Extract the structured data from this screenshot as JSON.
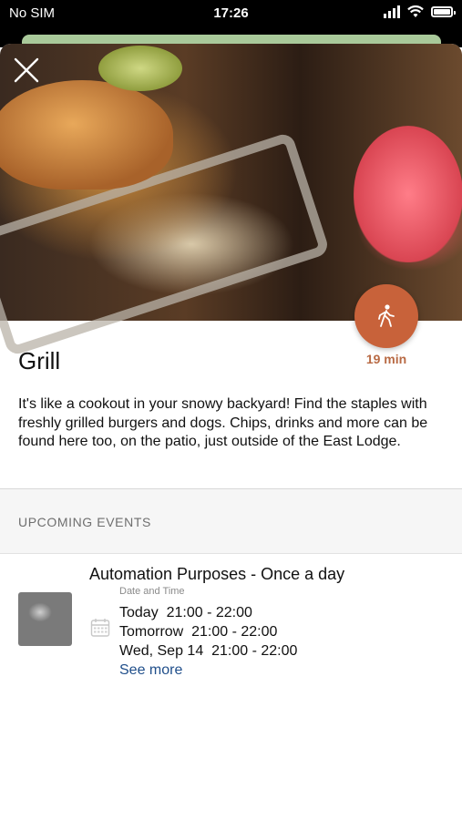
{
  "status_bar": {
    "carrier": "No SIM",
    "time": "17:26"
  },
  "place": {
    "title": "Grill",
    "walk_time": "19 min",
    "description": "It's like a cookout in your snowy backyard! Find the staples with freshly grilled burgers and dogs. Chips, drinks and more can be found here too, on the patio, just outside of the East Lodge."
  },
  "events": {
    "section_label": "UPCOMING EVENTS",
    "items": [
      {
        "title": "Automation Purposes - Once a day",
        "date_label": "Date and Time",
        "dates": [
          "Today  21:00 - 22:00",
          "Tomorrow  21:00 - 22:00",
          "Wed, Sep 14  21:00 - 22:00"
        ],
        "see_more": "See more"
      }
    ]
  },
  "colors": {
    "accent": "#c8623a",
    "link": "#1f4e8a"
  },
  "icons": [
    "close-icon",
    "walking-person-icon",
    "calendar-icon",
    "wifi-icon",
    "battery-icon",
    "signal-icon"
  ]
}
